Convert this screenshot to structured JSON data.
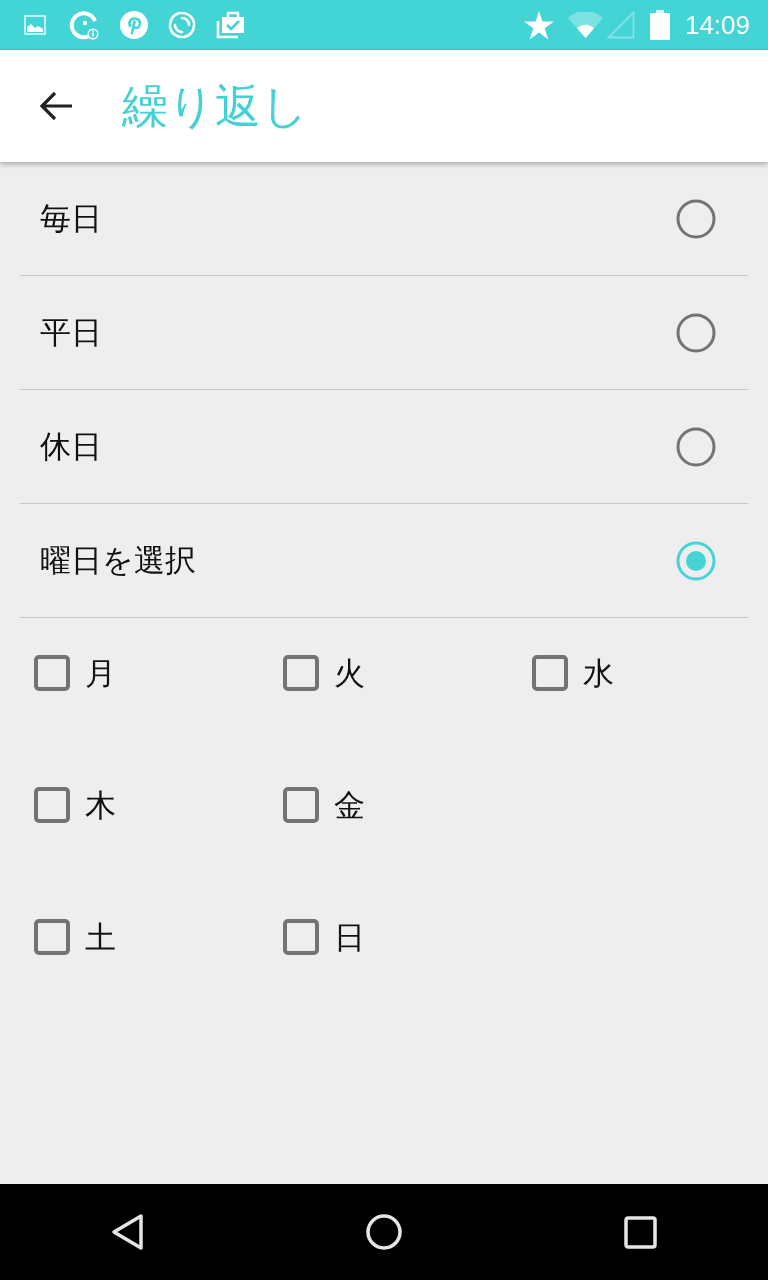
{
  "status_bar": {
    "time": "14:09"
  },
  "app_bar": {
    "title": "繰り返し"
  },
  "repeat_options": [
    {
      "label": "毎日",
      "selected": false
    },
    {
      "label": "平日",
      "selected": false
    },
    {
      "label": "休日",
      "selected": false
    },
    {
      "label": "曜日を選択",
      "selected": true
    }
  ],
  "weekday_rows": [
    {
      "days": [
        {
          "label": "月",
          "checked": false
        },
        {
          "label": "火",
          "checked": false
        },
        {
          "label": "水",
          "checked": false
        }
      ]
    },
    {
      "days": [
        {
          "label": "木",
          "checked": false
        },
        {
          "label": "金",
          "checked": false
        }
      ]
    },
    {
      "days": [
        {
          "label": "土",
          "checked": false
        },
        {
          "label": "日",
          "checked": false
        }
      ]
    }
  ]
}
